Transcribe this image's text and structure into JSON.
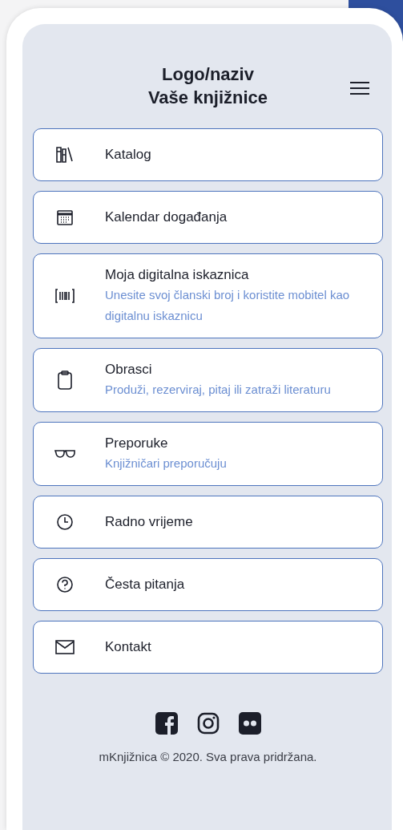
{
  "header": {
    "title_lines": [
      "Logo/naziv",
      "Vaše knjižnice"
    ]
  },
  "menu_items": [
    {
      "title": "Katalog"
    },
    {
      "title": "Kalendar događanja"
    },
    {
      "title": "Moja digitalna iskaznica",
      "subtitle": "Unesite svoj članski broj i koristite mobitel kao digitalnu iskaznicu"
    },
    {
      "title": "Obrasci",
      "subtitle": "Produži, rezerviraj, pitaj ili zatraži literaturu"
    },
    {
      "title": "Preporuke",
      "subtitle": "Knjižničari preporučuju"
    },
    {
      "title": "Radno vrijeme"
    },
    {
      "title": "Česta pitanja"
    },
    {
      "title": "Kontakt"
    }
  ],
  "footer": {
    "copyright": "mKnjižnica © 2020. Sva prava pridržana."
  }
}
